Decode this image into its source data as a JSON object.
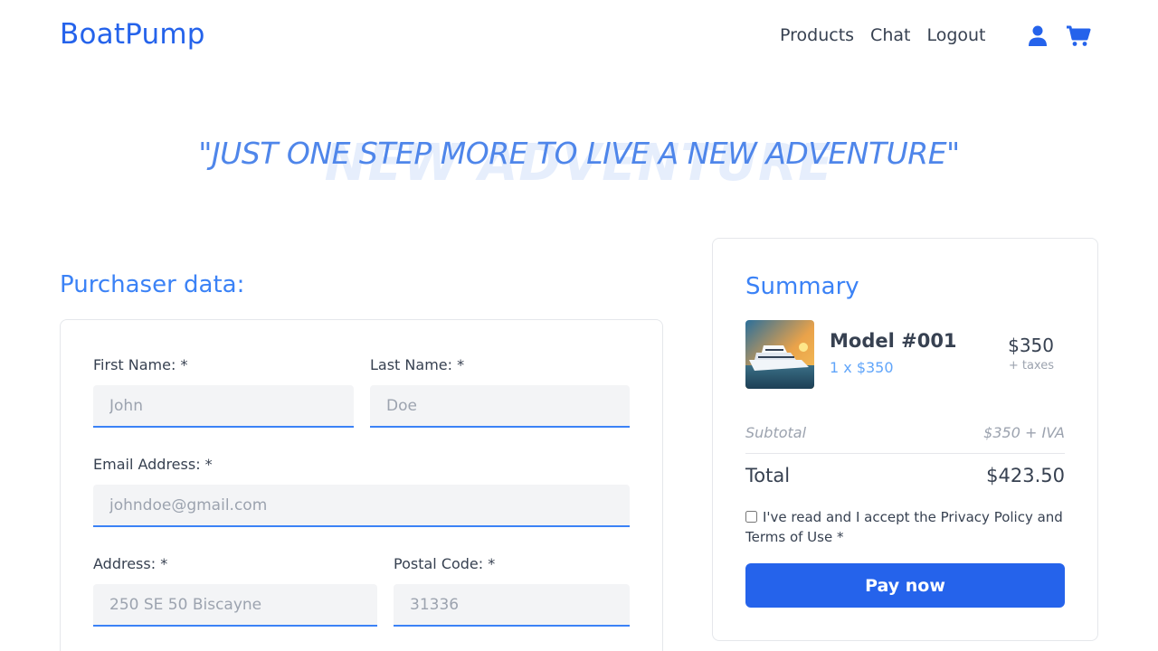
{
  "header": {
    "brand": "BoatPump",
    "nav": [
      "Products",
      "Chat",
      "Logout"
    ],
    "icons": [
      "user-icon",
      "cart-icon"
    ]
  },
  "hero": {
    "quote": "\"JUST ONE STEP MORE TO LIVE A NEW ADVENTURE\"",
    "background_text": "NEW ADVENTURE"
  },
  "purchaser": {
    "title": "Purchaser data:",
    "first_name": {
      "label": "First Name: *",
      "placeholder": "John"
    },
    "last_name": {
      "label": "Last Name: *",
      "placeholder": "Doe"
    },
    "email": {
      "label": "Email Address: *",
      "placeholder": "johndoe@gmail.com"
    },
    "address": {
      "label": "Address: *",
      "placeholder": "250 SE 50 Biscayne"
    },
    "postal_code": {
      "label": "Postal Code: *",
      "placeholder": "31336"
    }
  },
  "summary": {
    "title": "Summary",
    "product": {
      "name": "Model #001",
      "quantity": "1 x $350",
      "price": "$350",
      "taxes": "+ taxes"
    },
    "subtotal_label": "Subtotal",
    "subtotal_value": "$350 + IVA",
    "total_label": "Total",
    "total_value": "$423.50",
    "terms": "I've read and I accept the Privacy Policy and Terms of Use *",
    "pay_button": "Pay now"
  },
  "colors": {
    "accent": "#2563eb",
    "accent_light": "#3b82f6",
    "field_bg": "#f3f4f6"
  }
}
